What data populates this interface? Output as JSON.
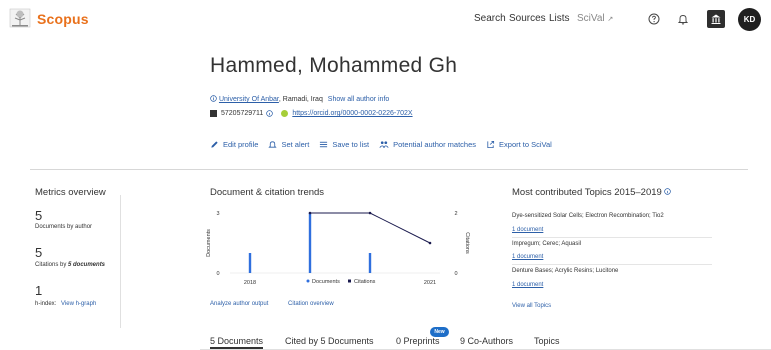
{
  "header": {
    "brand": "Scopus",
    "nav": [
      "Search",
      "Sources",
      "Lists",
      "SciVal"
    ],
    "scival_arrow": "↗",
    "avatar_initials": "KD",
    "icons": [
      "help-icon",
      "bell-icon",
      "institution-icon"
    ]
  },
  "profile": {
    "name": "Hammed, Mohammed Gh",
    "affiliation_name": "University Of Anbar",
    "affiliation_location": ", Ramadi, Iraq",
    "show_all_author_info": "Show all author info",
    "scopus_id": "57205729711",
    "orcid": "https://orcid.org/0000-0002-0226-702X"
  },
  "actions": [
    "Edit profile",
    "Set alert",
    "Save to list",
    "Potential author matches",
    "Export to SciVal"
  ],
  "metrics": {
    "title": "Metrics overview",
    "documents_value": "5",
    "documents_label": "Documents by author",
    "citations_value": "5",
    "citations_label_prefix": "Citations by ",
    "citations_label_emph": "5 documents",
    "hindex_value": "1",
    "hindex_label": "h-index:",
    "hindex_link": "View h-graph"
  },
  "trends": {
    "title": "Document & citation trends",
    "analyze_link": "Analyze author output",
    "citation_link": "Citation overview"
  },
  "chart_data": {
    "type": "bar",
    "categories": [
      "2018",
      "2019",
      "2020",
      "2021"
    ],
    "x_tick_labels": [
      "2018",
      "2021"
    ],
    "series": [
      {
        "name": "Documents",
        "type": "bar",
        "axis": "left",
        "values": [
          1,
          3,
          1,
          0
        ],
        "color": "#2f6fde"
      },
      {
        "name": "Citations",
        "type": "line",
        "axis": "right",
        "values": [
          null,
          2,
          2,
          1
        ],
        "color": "#1a1a4e"
      }
    ],
    "ylabel": "Documents",
    "y2label": "Citations",
    "ylim": [
      0,
      3
    ],
    "y2lim": [
      0,
      2
    ],
    "yticks": [
      0,
      3
    ],
    "y2ticks": [
      0,
      2
    ],
    "legend_position": "bottom"
  },
  "topics": {
    "title": "Most contributed Topics 2015–2019",
    "items": [
      {
        "name": "Dye-sensitized Solar Cells; Electron Recombination; Tio2",
        "docs": "1 document"
      },
      {
        "name": "Impregum; Cerec; Aquasil",
        "docs": "1 document"
      },
      {
        "name": "Denture Bases; Acrylic Resins; Lucitone",
        "docs": "1 document"
      }
    ],
    "view_all": "View all Topics"
  },
  "tabs": {
    "items": [
      "5 Documents",
      "Cited by 5 Documents",
      "0 Preprints",
      "9 Co-Authors",
      "Topics"
    ],
    "new_badge": "New"
  },
  "colors": {
    "brand_orange": "#e9711c",
    "link_blue": "#2c5fa8",
    "bar_blue": "#2f6fde",
    "line_navy": "#1a1a4e"
  }
}
